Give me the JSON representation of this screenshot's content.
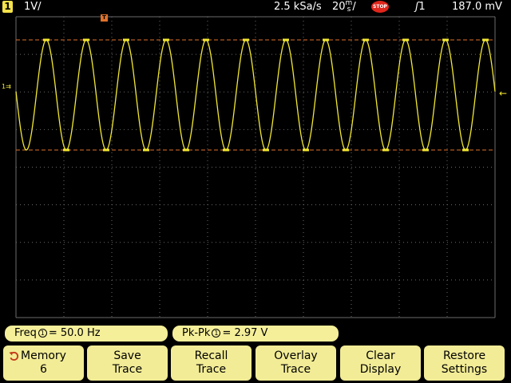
{
  "status": {
    "channel_badge": "1",
    "vdiv": "1V/",
    "sample_rate": "2.5 kSa/s",
    "timebase_value": "20",
    "timebase_unit_top": "m",
    "timebase_unit_bottom": "s",
    "timebase_slash": "/",
    "run_state": "STOP",
    "trigger_source": "1",
    "trigger_level": "187.0 mV"
  },
  "markers": {
    "trigger_pos": "T",
    "ground_left": "1",
    "trigger_level_arrow": "←"
  },
  "colors": {
    "trace": "#f2e832",
    "cursor": "#e0712a",
    "grid": "#6b6b6b",
    "softkey": "#f2ec96",
    "meas": "#f5ef9a",
    "stop": "#e0261c"
  },
  "waveform": {
    "type": "sine",
    "frequency_hz": 50.0,
    "cycles_visible": 12,
    "peak_to_peak_v": 2.97
  },
  "measurements": [
    {
      "label": "Freq",
      "channel": "1",
      "value": "= 50.0  Hz"
    },
    {
      "label": "Pk-Pk",
      "channel": "1",
      "value": "=  2.97  V"
    }
  ],
  "softkeys": [
    {
      "line1": "Memory",
      "line2": "6",
      "icon": "rotate-icon"
    },
    {
      "line1": "Save",
      "line2": "Trace"
    },
    {
      "line1": "Recall",
      "line2": "Trace"
    },
    {
      "line1": "Overlay",
      "line2": "Trace"
    },
    {
      "line1": "Clear",
      "line2": "Display"
    },
    {
      "line1": "Restore",
      "line2": "Settings"
    }
  ]
}
